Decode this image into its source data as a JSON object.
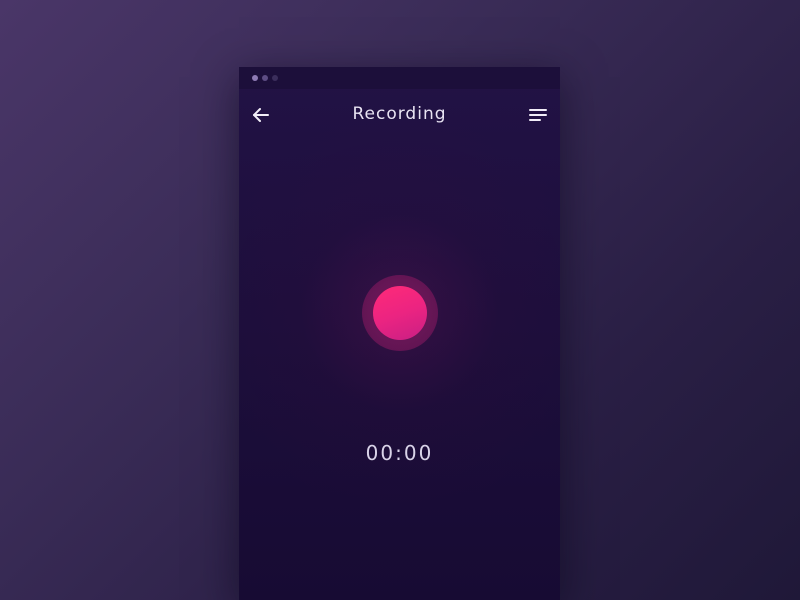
{
  "status_bar": {
    "dots": [
      "dot",
      "dot",
      "dot"
    ]
  },
  "header": {
    "title": "Recording",
    "back_icon": "arrow-left-icon",
    "menu_icon": "menu-lines-icon"
  },
  "recorder": {
    "button_icon": "record-icon",
    "accent_color": "#ff2a78",
    "timer": "00:00"
  },
  "colors": {
    "background": "#3a2c57",
    "panel": "#1d0f3d",
    "title_text": "#e8e3f2"
  }
}
